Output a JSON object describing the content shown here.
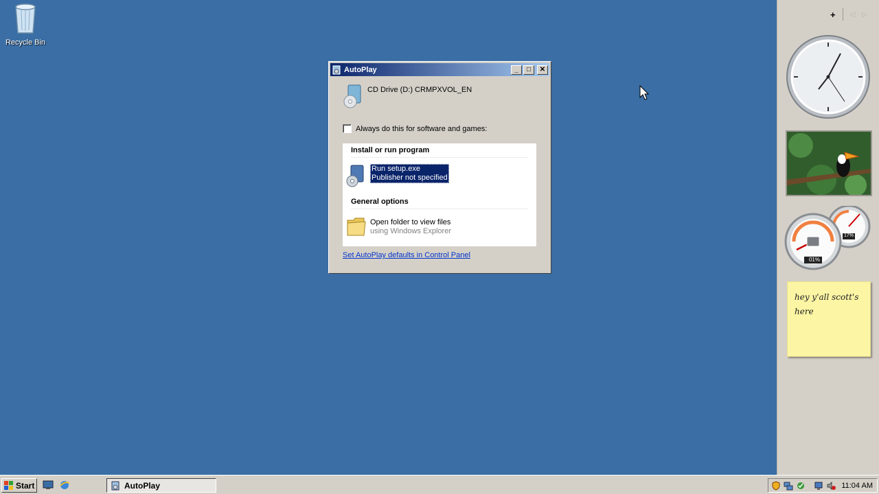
{
  "desktop": {
    "recycle_bin_label": "Recycle Bin"
  },
  "dialog": {
    "title": "AutoPlay",
    "drive_name": "CD Drive (D:) CRMPXVOL_EN",
    "always_label": "Always do this for software and games:",
    "always_checked": false,
    "section_install": "Install or run program",
    "run_option": {
      "line1": "Run setup.exe",
      "line2": "Publisher not specified"
    },
    "section_general": "General options",
    "open_folder_option": {
      "line1": "Open folder to view files",
      "line2": "using Windows Explorer"
    },
    "control_panel_link": "Set AutoPlay defaults in Control Panel"
  },
  "sidebar": {
    "clock_time": "11:04",
    "cpu_percent": 1,
    "memory_percent": 17,
    "cpu_label": "01%",
    "memory_label": "17%",
    "note_text": "hey y'all scott's here"
  },
  "taskbar": {
    "start_label": "Start",
    "task_button_label": "AutoPlay",
    "clock": "11:04 AM"
  },
  "colors": {
    "desktop_bg": "#3a6ea5",
    "titlebar_start": "#0a246a",
    "titlebar_end": "#a6caf0",
    "selection": "#0a246a",
    "link": "#0033cc"
  }
}
